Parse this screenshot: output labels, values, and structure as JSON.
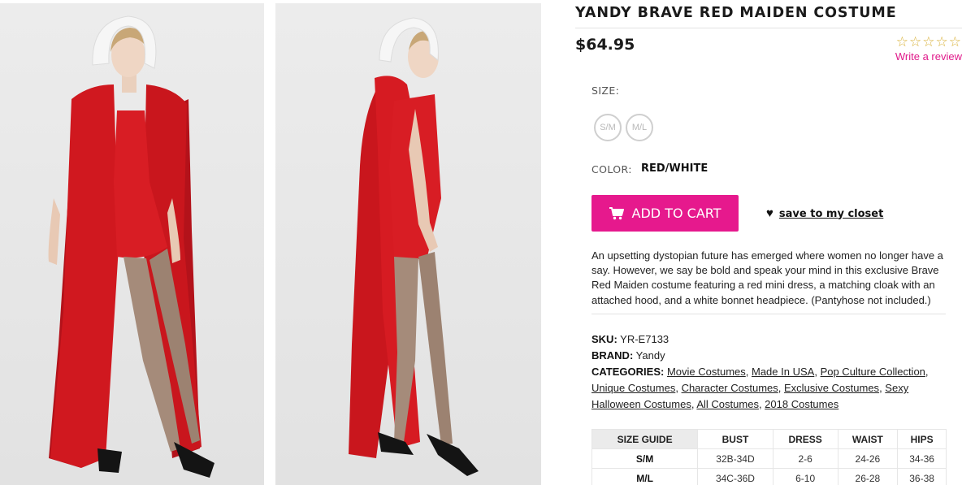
{
  "product": {
    "title": "YANDY BRAVE RED MAIDEN COSTUME",
    "price": "$64.95",
    "rating": {
      "stars": "☆☆☆☆☆",
      "write_review": "Write a review"
    },
    "size_label": "SIZE:",
    "sizes": [
      "S/M",
      "M/L"
    ],
    "color_label": "COLOR:",
    "color_value": "RED/WHITE",
    "add_to_cart": "ADD TO CART",
    "save_closet": "save to my closet",
    "description": "An upsetting dystopian future has emerged where women no longer have a say. However, we say be bold and speak your mind in this exclusive Brave Red Maiden costume featuring a red mini dress, a matching cloak with an attached hood, and a white bonnet headpiece. (Pantyhose not included.)",
    "sku_label": "SKU:",
    "sku": "YR-E7133",
    "brand_label": "BRAND:",
    "brand": "Yandy",
    "categories_label": "CATEGORIES:",
    "categories": [
      "Movie Costumes",
      "Made In USA",
      "Pop Culture Collection",
      "Unique Costumes",
      "Character Costumes",
      "Exclusive Costumes",
      "Sexy Halloween Costumes",
      "All Costumes",
      "2018 Costumes"
    ]
  },
  "size_guide": {
    "headers": [
      "SIZE GUIDE",
      "BUST",
      "DRESS",
      "WAIST",
      "HIPS"
    ],
    "rows": [
      [
        "S/M",
        "32B-34D",
        "2-6",
        "24-26",
        "34-36"
      ],
      [
        "M/L",
        "34C-36D",
        "6-10",
        "26-28",
        "36-38"
      ]
    ]
  },
  "colors": {
    "accent": "#e6198d",
    "star": "#d9b23a",
    "cloak": "#c8161b"
  },
  "icons": [
    "cart-icon",
    "heart-icon",
    "star-icon"
  ]
}
